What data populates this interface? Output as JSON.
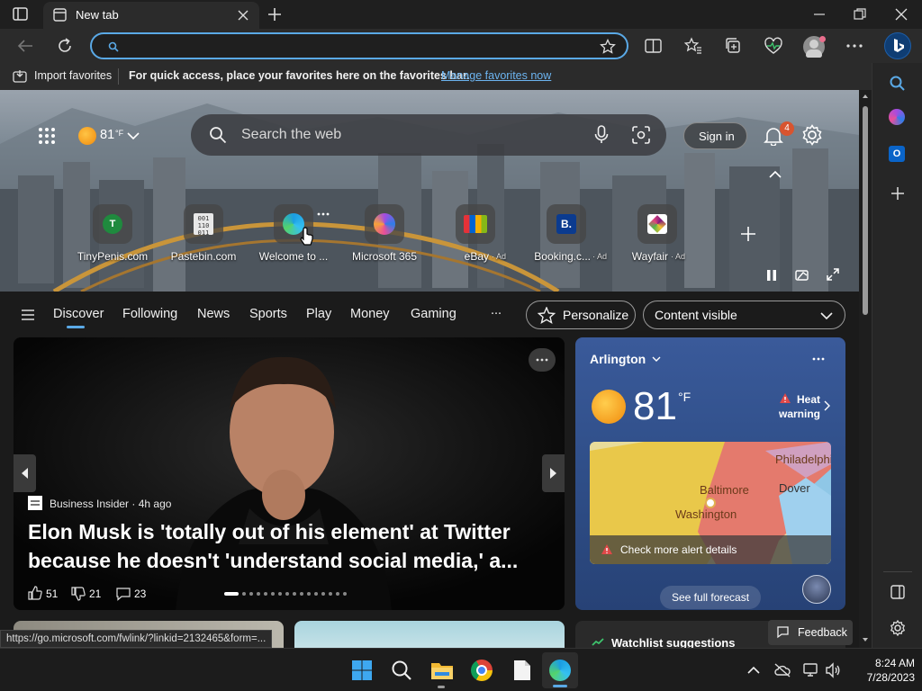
{
  "tab": {
    "title": "New tab"
  },
  "favorites_bar": {
    "import_label": "Import favorites",
    "message": "For quick access, place your favorites here on the favorites bar.",
    "manage_link": "Manage favorites now"
  },
  "header": {
    "weather_temp": "81",
    "weather_unit": "°F",
    "search_placeholder": "Search the web",
    "sign_in": "Sign in",
    "notification_count": "4"
  },
  "quick_links": [
    {
      "label": "TinyPenis.com",
      "ad": "",
      "icon": "letter-t-icon"
    },
    {
      "label": "Pastebin.com",
      "ad": "",
      "icon": "pastebin-icon"
    },
    {
      "label": "Welcome to ...",
      "ad": "",
      "icon": "edge-icon"
    },
    {
      "label": "Microsoft 365",
      "ad": "",
      "icon": "m365-icon"
    },
    {
      "label": "eBay",
      "ad": "· Ad",
      "icon": "ebay-icon"
    },
    {
      "label": "Booking.c...",
      "ad": "· Ad",
      "icon": "booking-icon"
    },
    {
      "label": "Wayfair",
      "ad": "· Ad",
      "icon": "wayfair-icon"
    }
  ],
  "nav": {
    "items": [
      "Discover",
      "Following",
      "News",
      "Sports",
      "Play",
      "Money",
      "Gaming"
    ],
    "more": "...",
    "personalize": "Personalize",
    "content_visible": "Content visible"
  },
  "hero_story": {
    "source": "Business Insider · 4h ago",
    "headline": "Elon Musk is 'totally out of his element' at Twitter because he doesn't 'understand social media,' a...",
    "likes": "51",
    "dislikes": "21",
    "comments": "23",
    "slide_count": 16,
    "active_slide": 1
  },
  "weather_card": {
    "location": "Arlington",
    "temp": "81",
    "unit": "°F",
    "alert": "Heat warning",
    "map_labels": [
      "Philadelphia",
      "Baltimore",
      "Dover",
      "Washington"
    ],
    "alert_details": "Check more alert details",
    "forecast_button": "See full forecast"
  },
  "lower": {
    "watchlist": "Watchlist suggestions",
    "feedback": "Feedback"
  },
  "status_url": "https://go.microsoft.com/fwlink/?linkid=2132465&form=...",
  "taskbar": {
    "time": "8:24 AM",
    "date": "7/28/2023"
  }
}
